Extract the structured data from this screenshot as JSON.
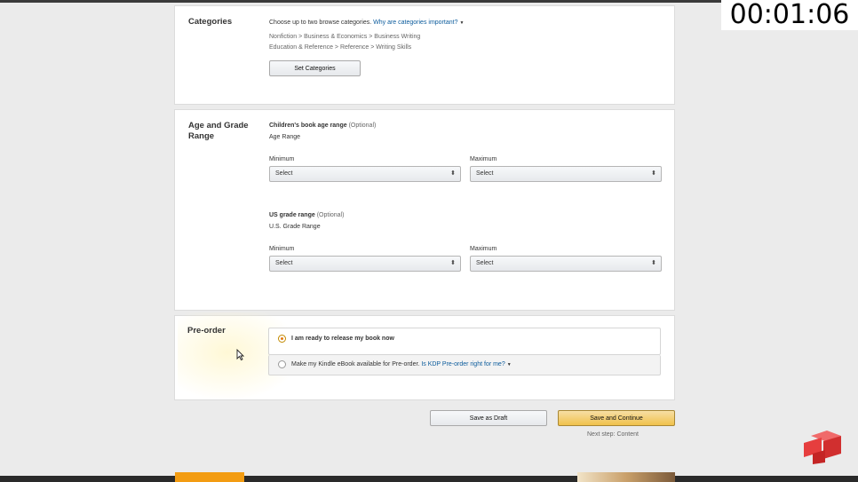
{
  "timer": "00:01:06",
  "categories": {
    "title": "Categories",
    "intro": "Choose up to two browse categories.",
    "help_link": "Why are categories important?",
    "items": [
      "Nonfiction > Business & Economics > Business Writing",
      "Education & Reference > Reference > Writing Skills"
    ],
    "button": "Set Categories"
  },
  "age_grade": {
    "title_line1": "Age and Grade",
    "title_line2": "Range",
    "childrens": {
      "label": "Children's book age range",
      "optional": "(Optional)",
      "sublabel": "Age Range",
      "min_label": "Minimum",
      "max_label": "Maximum",
      "min_value": "Select",
      "max_value": "Select"
    },
    "us_grade": {
      "label": "US grade range",
      "optional": "(Optional)",
      "sublabel": "U.S. Grade Range",
      "min_label": "Minimum",
      "max_label": "Maximum",
      "min_value": "Select",
      "max_value": "Select"
    }
  },
  "preorder": {
    "title": "Pre-order",
    "option1": "I am ready to release my book now",
    "option2": "Make my Kindle eBook available for Pre-order.",
    "option2_link": "Is KDP Pre-order right for me?",
    "selected": 1
  },
  "footer": {
    "save_draft": "Save as Draft",
    "save_continue": "Save and Continue",
    "next_step": "Next step: Content"
  },
  "colors": {
    "primary_button": "#f0c14b",
    "link": "#0b5b9c",
    "radio_selected": "#e47911"
  }
}
